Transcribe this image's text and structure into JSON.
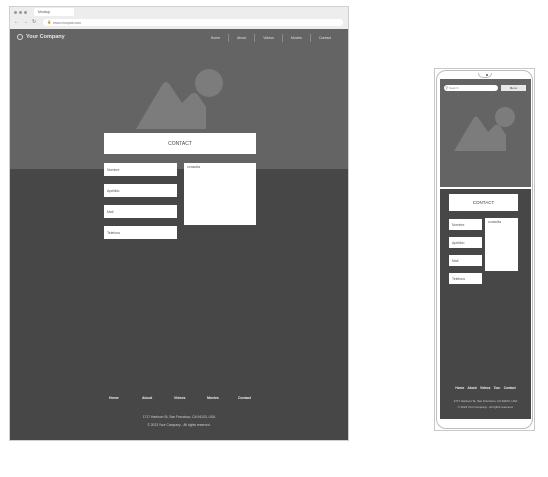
{
  "browser": {
    "tab_title": "Mockup",
    "url": "www.mospas.com",
    "nav_buttons": [
      "←",
      "→",
      "↻"
    ]
  },
  "site": {
    "company_name": "Your Company",
    "nav_items": [
      "Home",
      "About",
      "Videos",
      "Movies",
      "Contact"
    ],
    "contact_label": "CONTACT",
    "form": {
      "fields": [
        "Nombre",
        "Apellido",
        "Mail",
        "Telefono"
      ],
      "message_label": "consulta"
    },
    "footer": {
      "nav_items": [
        "Home",
        "About",
        "Videos",
        "Movies",
        "Contact"
      ],
      "address": "1717 Harrison St, San Francisco, CA 94103, USA",
      "copyright": "© 2023 Your Company - All rights reserved."
    }
  },
  "mobile": {
    "search_placeholder": "Search",
    "menu_label": "Menu",
    "contact_label": "CONTACT",
    "form": {
      "fields": [
        "Nombre",
        "Apellido",
        "Mail",
        "Telefono"
      ],
      "message_label": "consulta"
    },
    "footer": {
      "nav_items": [
        "Home",
        "About",
        "Videos",
        "Tour",
        "Contact"
      ],
      "address": "1717 Harrison St, San Francisco, CA 94103, USA",
      "copyright": "© 2023 Your Company - All rights reserved."
    }
  }
}
